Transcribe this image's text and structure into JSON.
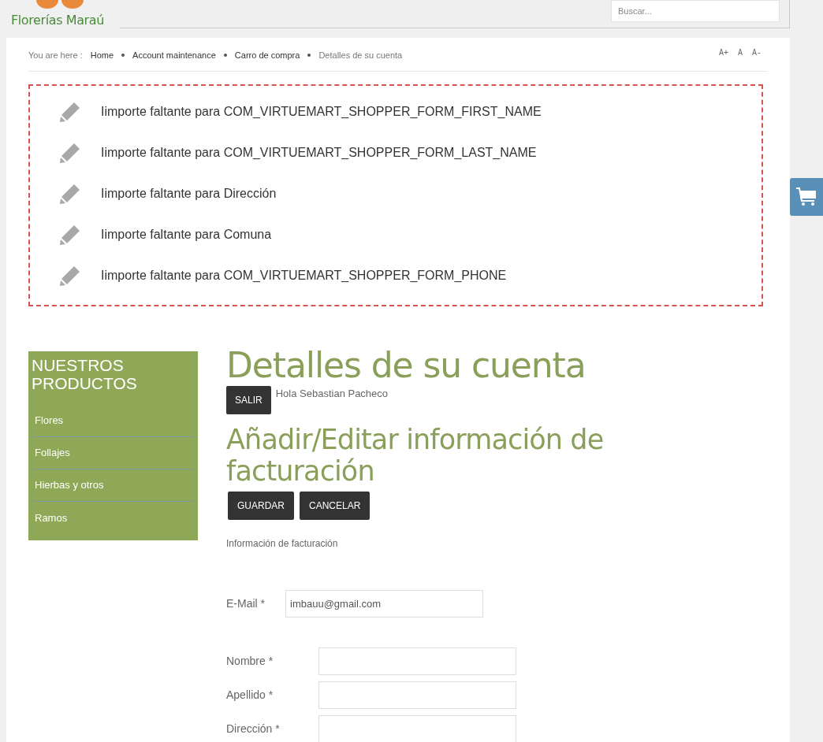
{
  "header": {
    "logo_text": "Florerías Maraú",
    "search": {
      "placeholder": "Buscar..."
    }
  },
  "breadcrumb": {
    "label": "You are here :",
    "items": [
      {
        "text": "Home",
        "link": true
      },
      {
        "text": "Account maintenance",
        "link": true
      },
      {
        "text": "Carro de compra",
        "link": true
      },
      {
        "text": "Detalles de su cuenta",
        "link": false
      }
    ]
  },
  "font_size_controls": [
    "A+",
    "A",
    "A-"
  ],
  "messages": [
    "Iimporte faltante para COM_VIRTUEMART_SHOPPER_FORM_FIRST_NAME",
    "Iimporte faltante para COM_VIRTUEMART_SHOPPER_FORM_LAST_NAME",
    "Iimporte faltante para Dirección",
    "Iimporte faltante para Comuna",
    "Iimporte faltante para COM_VIRTUEMART_SHOPPER_FORM_PHONE"
  ],
  "sidebar": {
    "title": "NUESTROS PRODUCTOS",
    "items": [
      "Flores",
      "Follajes",
      "Hierbas y otros",
      "Ramos"
    ]
  },
  "main": {
    "title": "Detalles de su cuenta",
    "logout_button": "SALIR",
    "greeting": "Hola Sebastian Pacheco",
    "subtitle": "Añadir/Editar información de facturación",
    "buttons": [
      "GUARDAR",
      "CANCELAR"
    ],
    "section_label": "Información de facturación",
    "email_field": {
      "label": "E-Mail *",
      "value": "imbauu@gmail.com"
    },
    "fields": [
      {
        "label": "Nombre *"
      },
      {
        "label": "Apellido *"
      },
      {
        "label": "Dirección *"
      }
    ]
  }
}
